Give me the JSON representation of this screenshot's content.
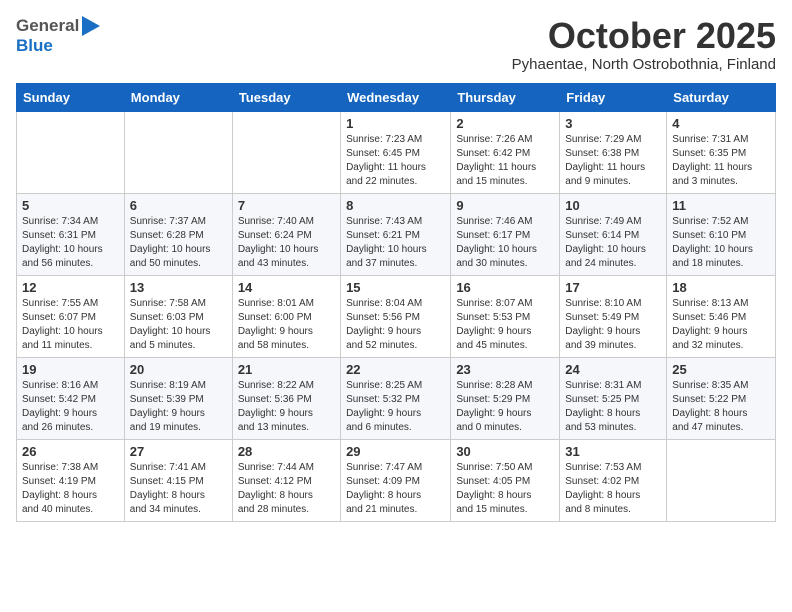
{
  "header": {
    "logo_general": "General",
    "logo_blue": "Blue",
    "month": "October 2025",
    "location": "Pyhaentae, North Ostrobothnia, Finland"
  },
  "weekdays": [
    "Sunday",
    "Monday",
    "Tuesday",
    "Wednesday",
    "Thursday",
    "Friday",
    "Saturday"
  ],
  "weeks": [
    [
      {
        "day": "",
        "info": ""
      },
      {
        "day": "",
        "info": ""
      },
      {
        "day": "",
        "info": ""
      },
      {
        "day": "1",
        "info": "Sunrise: 7:23 AM\nSunset: 6:45 PM\nDaylight: 11 hours\nand 22 minutes."
      },
      {
        "day": "2",
        "info": "Sunrise: 7:26 AM\nSunset: 6:42 PM\nDaylight: 11 hours\nand 15 minutes."
      },
      {
        "day": "3",
        "info": "Sunrise: 7:29 AM\nSunset: 6:38 PM\nDaylight: 11 hours\nand 9 minutes."
      },
      {
        "day": "4",
        "info": "Sunrise: 7:31 AM\nSunset: 6:35 PM\nDaylight: 11 hours\nand 3 minutes."
      }
    ],
    [
      {
        "day": "5",
        "info": "Sunrise: 7:34 AM\nSunset: 6:31 PM\nDaylight: 10 hours\nand 56 minutes."
      },
      {
        "day": "6",
        "info": "Sunrise: 7:37 AM\nSunset: 6:28 PM\nDaylight: 10 hours\nand 50 minutes."
      },
      {
        "day": "7",
        "info": "Sunrise: 7:40 AM\nSunset: 6:24 PM\nDaylight: 10 hours\nand 43 minutes."
      },
      {
        "day": "8",
        "info": "Sunrise: 7:43 AM\nSunset: 6:21 PM\nDaylight: 10 hours\nand 37 minutes."
      },
      {
        "day": "9",
        "info": "Sunrise: 7:46 AM\nSunset: 6:17 PM\nDaylight: 10 hours\nand 30 minutes."
      },
      {
        "day": "10",
        "info": "Sunrise: 7:49 AM\nSunset: 6:14 PM\nDaylight: 10 hours\nand 24 minutes."
      },
      {
        "day": "11",
        "info": "Sunrise: 7:52 AM\nSunset: 6:10 PM\nDaylight: 10 hours\nand 18 minutes."
      }
    ],
    [
      {
        "day": "12",
        "info": "Sunrise: 7:55 AM\nSunset: 6:07 PM\nDaylight: 10 hours\nand 11 minutes."
      },
      {
        "day": "13",
        "info": "Sunrise: 7:58 AM\nSunset: 6:03 PM\nDaylight: 10 hours\nand 5 minutes."
      },
      {
        "day": "14",
        "info": "Sunrise: 8:01 AM\nSunset: 6:00 PM\nDaylight: 9 hours\nand 58 minutes."
      },
      {
        "day": "15",
        "info": "Sunrise: 8:04 AM\nSunset: 5:56 PM\nDaylight: 9 hours\nand 52 minutes."
      },
      {
        "day": "16",
        "info": "Sunrise: 8:07 AM\nSunset: 5:53 PM\nDaylight: 9 hours\nand 45 minutes."
      },
      {
        "day": "17",
        "info": "Sunrise: 8:10 AM\nSunset: 5:49 PM\nDaylight: 9 hours\nand 39 minutes."
      },
      {
        "day": "18",
        "info": "Sunrise: 8:13 AM\nSunset: 5:46 PM\nDaylight: 9 hours\nand 32 minutes."
      }
    ],
    [
      {
        "day": "19",
        "info": "Sunrise: 8:16 AM\nSunset: 5:42 PM\nDaylight: 9 hours\nand 26 minutes."
      },
      {
        "day": "20",
        "info": "Sunrise: 8:19 AM\nSunset: 5:39 PM\nDaylight: 9 hours\nand 19 minutes."
      },
      {
        "day": "21",
        "info": "Sunrise: 8:22 AM\nSunset: 5:36 PM\nDaylight: 9 hours\nand 13 minutes."
      },
      {
        "day": "22",
        "info": "Sunrise: 8:25 AM\nSunset: 5:32 PM\nDaylight: 9 hours\nand 6 minutes."
      },
      {
        "day": "23",
        "info": "Sunrise: 8:28 AM\nSunset: 5:29 PM\nDaylight: 9 hours\nand 0 minutes."
      },
      {
        "day": "24",
        "info": "Sunrise: 8:31 AM\nSunset: 5:25 PM\nDaylight: 8 hours\nand 53 minutes."
      },
      {
        "day": "25",
        "info": "Sunrise: 8:35 AM\nSunset: 5:22 PM\nDaylight: 8 hours\nand 47 minutes."
      }
    ],
    [
      {
        "day": "26",
        "info": "Sunrise: 7:38 AM\nSunset: 4:19 PM\nDaylight: 8 hours\nand 40 minutes."
      },
      {
        "day": "27",
        "info": "Sunrise: 7:41 AM\nSunset: 4:15 PM\nDaylight: 8 hours\nand 34 minutes."
      },
      {
        "day": "28",
        "info": "Sunrise: 7:44 AM\nSunset: 4:12 PM\nDaylight: 8 hours\nand 28 minutes."
      },
      {
        "day": "29",
        "info": "Sunrise: 7:47 AM\nSunset: 4:09 PM\nDaylight: 8 hours\nand 21 minutes."
      },
      {
        "day": "30",
        "info": "Sunrise: 7:50 AM\nSunset: 4:05 PM\nDaylight: 8 hours\nand 15 minutes."
      },
      {
        "day": "31",
        "info": "Sunrise: 7:53 AM\nSunset: 4:02 PM\nDaylight: 8 hours\nand 8 minutes."
      },
      {
        "day": "",
        "info": ""
      }
    ]
  ]
}
